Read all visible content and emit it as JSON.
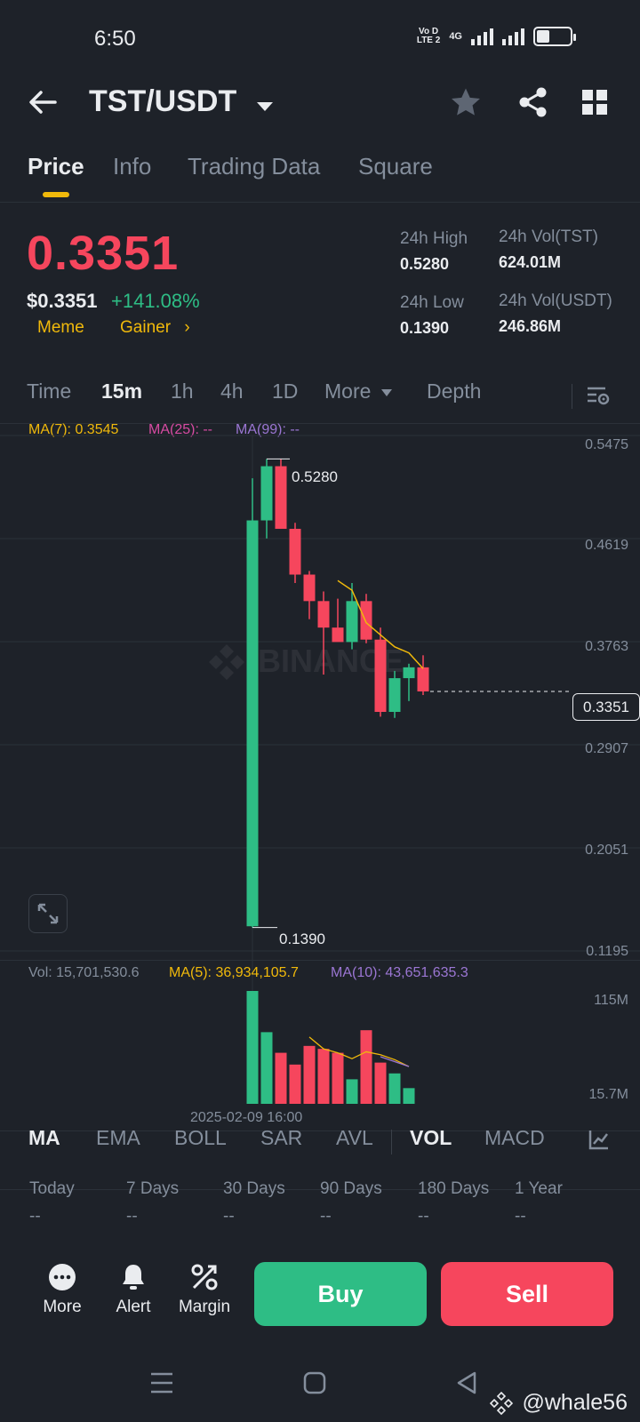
{
  "status_bar": {
    "time": "6:50",
    "net_top": "Vo D",
    "net_bottom": "LTE 2",
    "net_4g": "4G",
    "battery_level": 0.4
  },
  "header": {
    "pair": "TST/USDT"
  },
  "tabs": [
    "Price",
    "Info",
    "Trading Data",
    "Square"
  ],
  "price": {
    "last": "0.3351",
    "usd": "$0.3351",
    "change": "+141.08%",
    "tags": [
      "Meme",
      "Gainer"
    ],
    "high_label": "24h High",
    "high": "0.5280",
    "low_label": "24h Low",
    "low": "0.1390",
    "vol_tst_label": "24h Vol(TST)",
    "vol_tst": "624.01M",
    "vol_usdt_label": "24h Vol(USDT)",
    "vol_usdt": "246.86M"
  },
  "timeframes": [
    "Time",
    "15m",
    "1h",
    "4h",
    "1D",
    "More",
    "Depth"
  ],
  "chart_legend": {
    "ma7": "MA(7): 0.3545",
    "ma25": "MA(25): --",
    "ma99": "MA(99): --"
  },
  "price_axis": [
    "0.5475",
    "0.4619",
    "0.3763",
    "0.2907",
    "0.2051",
    "0.1195"
  ],
  "current_price_tag": "0.3351",
  "annotations": {
    "high": "0.5280",
    "low": "0.1390"
  },
  "vol_legend": {
    "vol": "Vol: 15,701,530.6",
    "ma5": "MA(5): 36,934,105.7",
    "ma10": "MA(10): 43,651,635.3"
  },
  "vol_axis": {
    "top": "115M",
    "bottom": "15.7M"
  },
  "x_label": "2025-02-09 16:00",
  "indicator_tabs": [
    "MA",
    "EMA",
    "BOLL",
    "SAR",
    "AVL",
    "VOL",
    "MACD"
  ],
  "periods": [
    {
      "label": "Today",
      "value": "--"
    },
    {
      "label": "7 Days",
      "value": "--"
    },
    {
      "label": "30 Days",
      "value": "--"
    },
    {
      "label": "90 Days",
      "value": "--"
    },
    {
      "label": "180 Days",
      "value": "--"
    },
    {
      "label": "1 Year",
      "value": "--"
    }
  ],
  "bottom_bar": {
    "more": "More",
    "alert": "Alert",
    "margin": "Margin",
    "buy": "Buy",
    "sell": "Sell"
  },
  "watermark": "@whale56",
  "colors": {
    "up": "#2ebd85",
    "down": "#f6465d",
    "accent": "#f0b90b",
    "ma7": "#f0b90b",
    "ma25": "#d74ba2",
    "ma99": "#9b76d3"
  },
  "chart_data": {
    "type": "candlestick",
    "price_range": [
      0.1195,
      0.5475
    ],
    "candles": [
      {
        "o": 0.14,
        "h": 0.512,
        "l": 0.139,
        "c": 0.477
      },
      {
        "o": 0.477,
        "h": 0.528,
        "l": 0.462,
        "c": 0.522
      },
      {
        "o": 0.522,
        "h": 0.528,
        "l": 0.47,
        "c": 0.47
      },
      {
        "o": 0.47,
        "h": 0.475,
        "l": 0.425,
        "c": 0.432
      },
      {
        "o": 0.432,
        "h": 0.435,
        "l": 0.395,
        "c": 0.41
      },
      {
        "o": 0.41,
        "h": 0.418,
        "l": 0.349,
        "c": 0.388
      },
      {
        "o": 0.388,
        "h": 0.412,
        "l": 0.378,
        "c": 0.376
      },
      {
        "o": 0.376,
        "h": 0.425,
        "l": 0.37,
        "c": 0.41
      },
      {
        "o": 0.41,
        "h": 0.416,
        "l": 0.375,
        "c": 0.378
      },
      {
        "o": 0.378,
        "h": 0.388,
        "l": 0.314,
        "c": 0.318
      },
      {
        "o": 0.318,
        "h": 0.352,
        "l": 0.313,
        "c": 0.346
      },
      {
        "o": 0.346,
        "h": 0.358,
        "l": 0.327,
        "c": 0.355
      },
      {
        "o": 0.355,
        "h": 0.365,
        "l": 0.332,
        "c": 0.335
      }
    ],
    "ma7": [
      null,
      null,
      null,
      null,
      null,
      null,
      0.427,
      0.419,
      0.392,
      0.382,
      0.372,
      0.367,
      0.354
    ],
    "volume_range": [
      0,
      115
    ],
    "volumes": [
      115,
      73,
      52,
      40,
      59,
      56,
      52,
      25,
      75,
      42,
      31,
      16
    ],
    "volume_ma5": [
      null,
      null,
      null,
      null,
      68,
      56,
      52,
      46,
      53,
      50,
      45,
      38
    ],
    "volume_ma10": [
      null,
      null,
      null,
      null,
      null,
      null,
      null,
      null,
      null,
      48,
      43,
      38
    ]
  }
}
